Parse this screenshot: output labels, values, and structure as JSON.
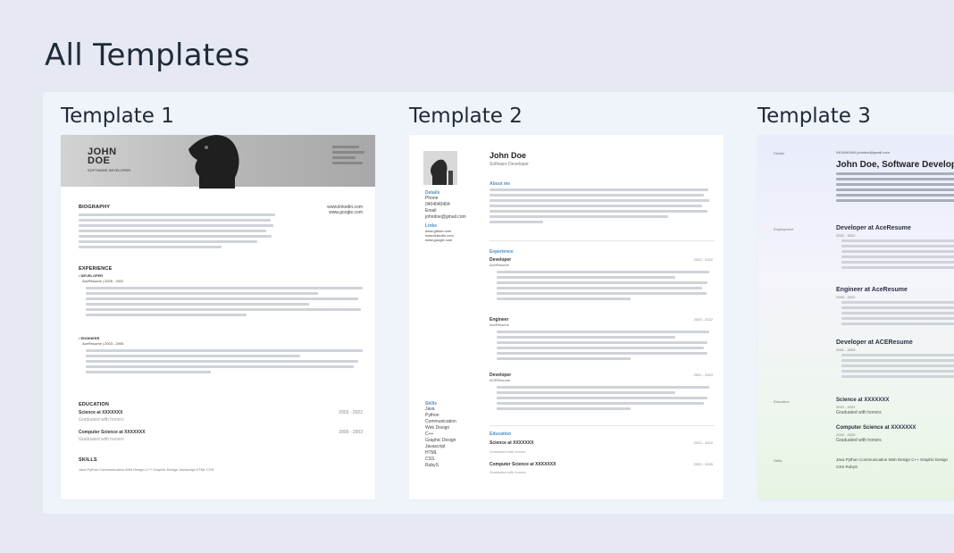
{
  "page": {
    "title": "All Templates"
  },
  "templates": [
    {
      "title": "Template 1",
      "preview": {
        "name_line1": "JOHN",
        "name_line2": "DOE",
        "role": "SOFTWARE DEVELOPER",
        "links": [
          "www.linkedin.com",
          "www.google.com"
        ],
        "sections": {
          "biography": "BIOGRAPHY",
          "experience": "EXPERIENCE",
          "education": "EDUCATION",
          "skills": "SKILLS"
        },
        "jobs": [
          {
            "title": "• DEVELOPER",
            "company": "AceResume | 2005 - 2022"
          },
          {
            "title": "• ENGINEER",
            "company": "AceResume | 2003 - 2005"
          }
        ],
        "education": [
          {
            "degree": "Science at XXXXXXX",
            "note": "Graduated with honors",
            "years": "2003 - 2022"
          },
          {
            "degree": "Computer Science at XXXXXXX",
            "note": "Graduated with honors",
            "years": "2000 - 2003"
          }
        ],
        "skills": "Java   Python   Communication   Web Design   C++   Graphic Design   Javascript   HTML   CSS"
      }
    },
    {
      "title": "Template 2",
      "preview": {
        "name": "John Doe",
        "role": "Software Developer",
        "about_heading": "About me",
        "details_heading": "Details",
        "details": [
          "Phone",
          "0404040404",
          "Email",
          "johndoe@gmail.com"
        ],
        "links_heading": "Links",
        "links": [
          "www.github.com",
          "www.linkedin.com",
          "www.google.com"
        ],
        "experience_heading": "Experience",
        "jobs": [
          {
            "title": "Developer",
            "company": "AceResume",
            "years": "2022 - 2022"
          },
          {
            "title": "Engineer",
            "company": "AceResume",
            "years": "2005 - 2022"
          },
          {
            "title": "Developer",
            "company": "ACEResume",
            "years": "2001 - 2003"
          }
        ],
        "skills_heading": "Skills",
        "skills": [
          "Java",
          "Python",
          "Communication",
          "Web Design",
          "C++",
          "Graphic Design",
          "Javascript",
          "HTML",
          "CSS",
          "RubyS"
        ],
        "education_heading": "Education",
        "education": [
          {
            "degree": "Science at XXXXXXX",
            "note": "Graduated with honors",
            "years": "2022 - 2022"
          },
          {
            "degree": "Computer Science at XXXXXXX",
            "note": "Graduated with honors",
            "years": "2020 - 2020"
          }
        ]
      }
    },
    {
      "title": "Template 3",
      "preview": {
        "details_label": "Details",
        "contact": "0404040404   johndoe@gmail.com",
        "headline": "John Doe, Software Developer",
        "employment_label": "Employment",
        "jobs": [
          {
            "title": "Developer at AceResume",
            "years": "2022 - 2022"
          },
          {
            "title": "Engineer at AceResume",
            "years": "2005 - 2022"
          },
          {
            "title": "Developer at ACEResume",
            "years": "2001 - 2003"
          }
        ],
        "education_label": "Education",
        "education": [
          {
            "degree": "Science at XXXXXXX",
            "years": "2022 - 2022",
            "note": "Graduated with honors"
          },
          {
            "degree": "Computer Science at XXXXXXX",
            "years": "2020 - 2020",
            "note": "Graduated with honors"
          }
        ],
        "skills_label": "Skills",
        "skills": "Java  Python  Communication  Web Design  C++  Graphic Design",
        "skills_line2": "CSS  RubyS"
      }
    }
  ]
}
